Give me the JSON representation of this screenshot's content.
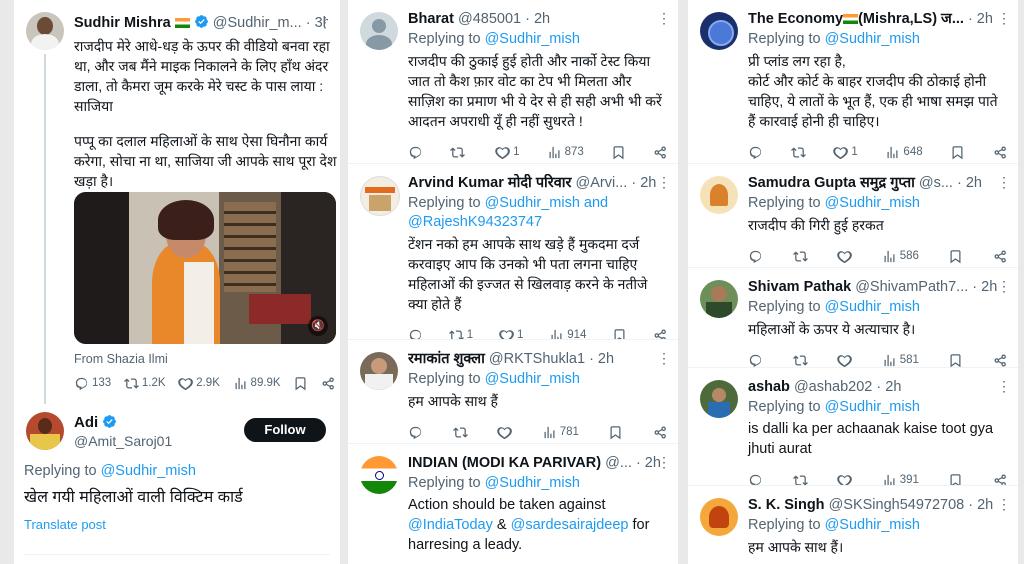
{
  "left": {
    "main": {
      "name": "Sudhir Mishra",
      "handle": "@Sudhir_m...",
      "time": "3h",
      "text": "राजदीप मेरे आधे-धड़ के ऊपर की वीडियो बनवा रहा था, और जब मैंने माइक निकालने के लिए हाँथ अंदर डाला, तो कैमरा जूम करके मेरे चस्ट के पास लाया : साजिया",
      "text2": "पप्पू का दलाल महिलाओं के साथ ऐसा घिनौना कार्य करेगा, सोचा ना था, साजिया जी आपके साथ पूरा देश खड़ा है।",
      "media_from": "From Shazia Ilmi",
      "stats": {
        "replies": "133",
        "retweets": "1.2K",
        "likes": "2.9K",
        "views": "89.9K"
      }
    },
    "reply": {
      "name": "Adi",
      "handle": "@Amit_Saroj01",
      "follow": "Follow",
      "replying_prefix": "Replying to",
      "replying_to": "@Sudhir_mish",
      "text": "खेल गयी महिलाओं वाली विक्टिम कार्ड",
      "translate": "Translate post"
    }
  },
  "middle": [
    {
      "name": "Bharat",
      "handle": "@485001",
      "time": "· 2h",
      "replying": "@Sudhir_mish",
      "replying_extra": "",
      "text": "राजदीप की ठुकाई हुई होती और नार्को टेस्ट किया जात तो कैश फ़ार वोट का टेप भी मिलता और साज़िश का प्रमाण भी ये देर से ही सही अभी भी करें आदतन अपराधी यूँ ही नहीं सुधरते !",
      "retweets": "",
      "likes": "1",
      "views": "873"
    },
    {
      "name": "Arvind Kumar मोदी परिवार",
      "handle": "@Arvi...",
      "time": "· 2h",
      "replying": "@Sudhir_mish and",
      "replying_extra": "@RajeshK94323747",
      "text": "टेंशन नको हम आपके साथ खड़े हैं मुकदमा दर्ज करवाइए आप कि उनको भी पता लगना चाहिए महिलाओं की इज्जत से खिलवाड़ करने के नतीजे क्या होते हैं",
      "retweets": "1",
      "likes": "1",
      "views": "914"
    },
    {
      "name": "रमाकांत शुक्ला",
      "handle": "@RKTShukla1",
      "time": "· 2h",
      "replying": "@Sudhir_mish",
      "replying_extra": "",
      "text": "हम आपके साथ हैं",
      "retweets": "",
      "likes": "",
      "views": "781"
    },
    {
      "name": "INDIAN (MODI KA PARIVAR)",
      "handle": "@...",
      "time": "· 2h",
      "replying": "@Sudhir_mish",
      "replying_extra": "",
      "text_plain": "Action should be taken against",
      "mention1": "@IndiaToday",
      "amp": "&",
      "mention2": "@sardesairajdeep",
      "text_plain2": "for harresing a leady."
    }
  ],
  "right": [
    {
      "name": "The Economy",
      "name_tail": "(Mishra,LS) ज...",
      "time": "· 2h",
      "replying": "@Sudhir_mish",
      "text": "प्री प्लांड लग रहा है,\nकोर्ट और कोर्ट के बाहर राजदीप की ठोकाई होनी चाहिए, ये लातों के भूत हैं, एक ही भाषा समझ पाते हैं कारवाई होनी ही चाहिए।",
      "retweets": "",
      "likes": "1",
      "views": "648"
    },
    {
      "name": "Samudra Gupta समुद्र गुप्ता",
      "handle": "@s...",
      "time": "· 2h",
      "replying": "@Sudhir_mish",
      "text": "राजदीप की गिरी हुई हरकत",
      "retweets": "",
      "likes": "",
      "views": "586"
    },
    {
      "name": "Shivam Pathak",
      "handle": "@ShivamPath7...",
      "time": "· 2h",
      "replying": "@Sudhir_mish",
      "text": "महिलाओं के ऊपर ये अत्याचार है।",
      "retweets": "",
      "likes": "",
      "views": "581"
    },
    {
      "name": "ashab",
      "handle": "@ashab202",
      "time": "· 2h",
      "replying": "@Sudhir_mish",
      "text": "is dalli ka per achaanak kaise toot gya jhuti aurat",
      "retweets": "",
      "likes": "",
      "views": "391"
    },
    {
      "name": "S. K. Singh",
      "handle": "@SKSingh54972708",
      "time": "· 2h",
      "replying": "@Sudhir_mish",
      "text": "हम आपके साथ हैं।"
    }
  ],
  "icons": {
    "more": "more-dots-icon",
    "reply": "reply-icon",
    "retweet": "retweet-icon",
    "like": "heart-icon",
    "views": "views-icon",
    "bookmark": "bookmark-icon",
    "share": "share-icon",
    "verified": "verified-badge-icon",
    "mute": "mute-icon",
    "flag": "india-flag-icon"
  },
  "colors": {
    "link": "#1d9bf0",
    "muted": "#536471",
    "text": "#0f1419",
    "follow_bg": "#0f1419"
  }
}
